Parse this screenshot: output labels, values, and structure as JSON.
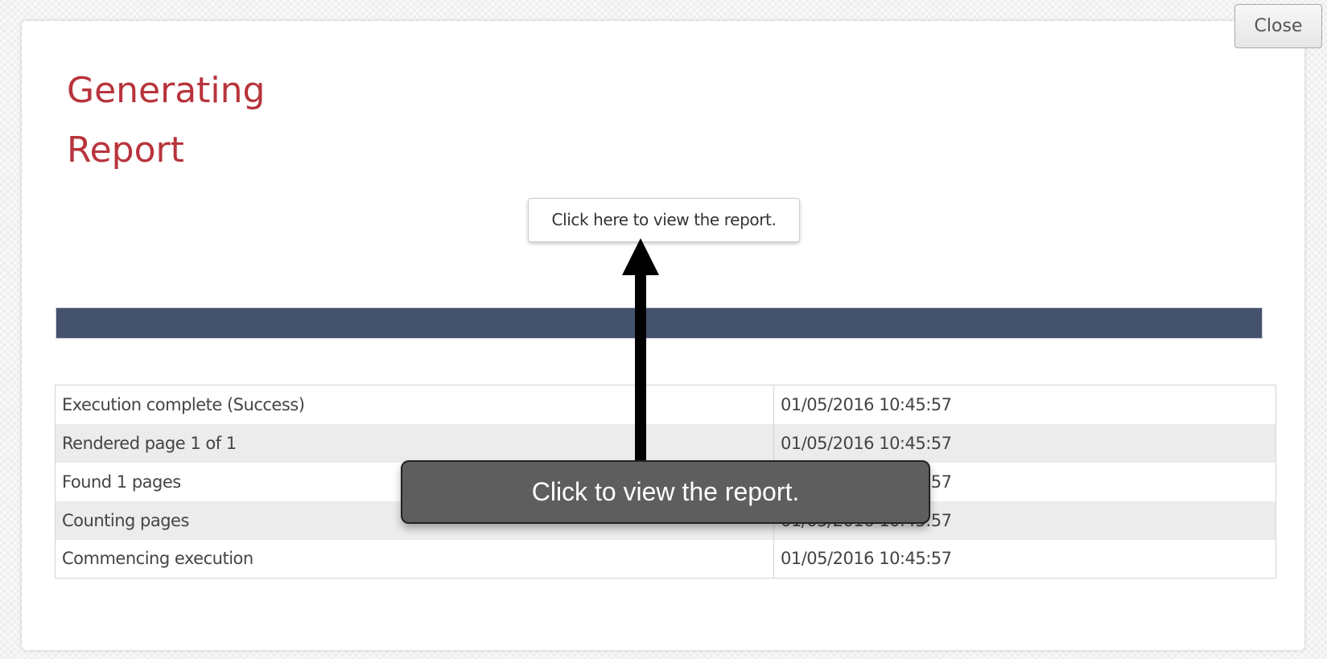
{
  "dialog": {
    "title_line1": "Generating",
    "title_line2": "Report",
    "close_label": "Close",
    "view_report_label": "Click here to view the report.",
    "progress": 1.0,
    "log": [
      {
        "message": "Execution complete (Success)",
        "time": "01/05/2016 10:45:57"
      },
      {
        "message": "Rendered page 1 of 1",
        "time": "01/05/2016 10:45:57"
      },
      {
        "message": "Found 1 pages",
        "time": "01/05/2016 10:45:57"
      },
      {
        "message": "Counting pages",
        "time": "01/05/2016 10:45:57"
      },
      {
        "message": "Commencing execution",
        "time": "01/05/2016 10:45:57"
      }
    ]
  },
  "annotation": {
    "callout_text": "Click to view the report."
  },
  "colors": {
    "title": "#b8343c",
    "progress_fill": "#45526e",
    "callout_bg": "#5e5e5e"
  }
}
